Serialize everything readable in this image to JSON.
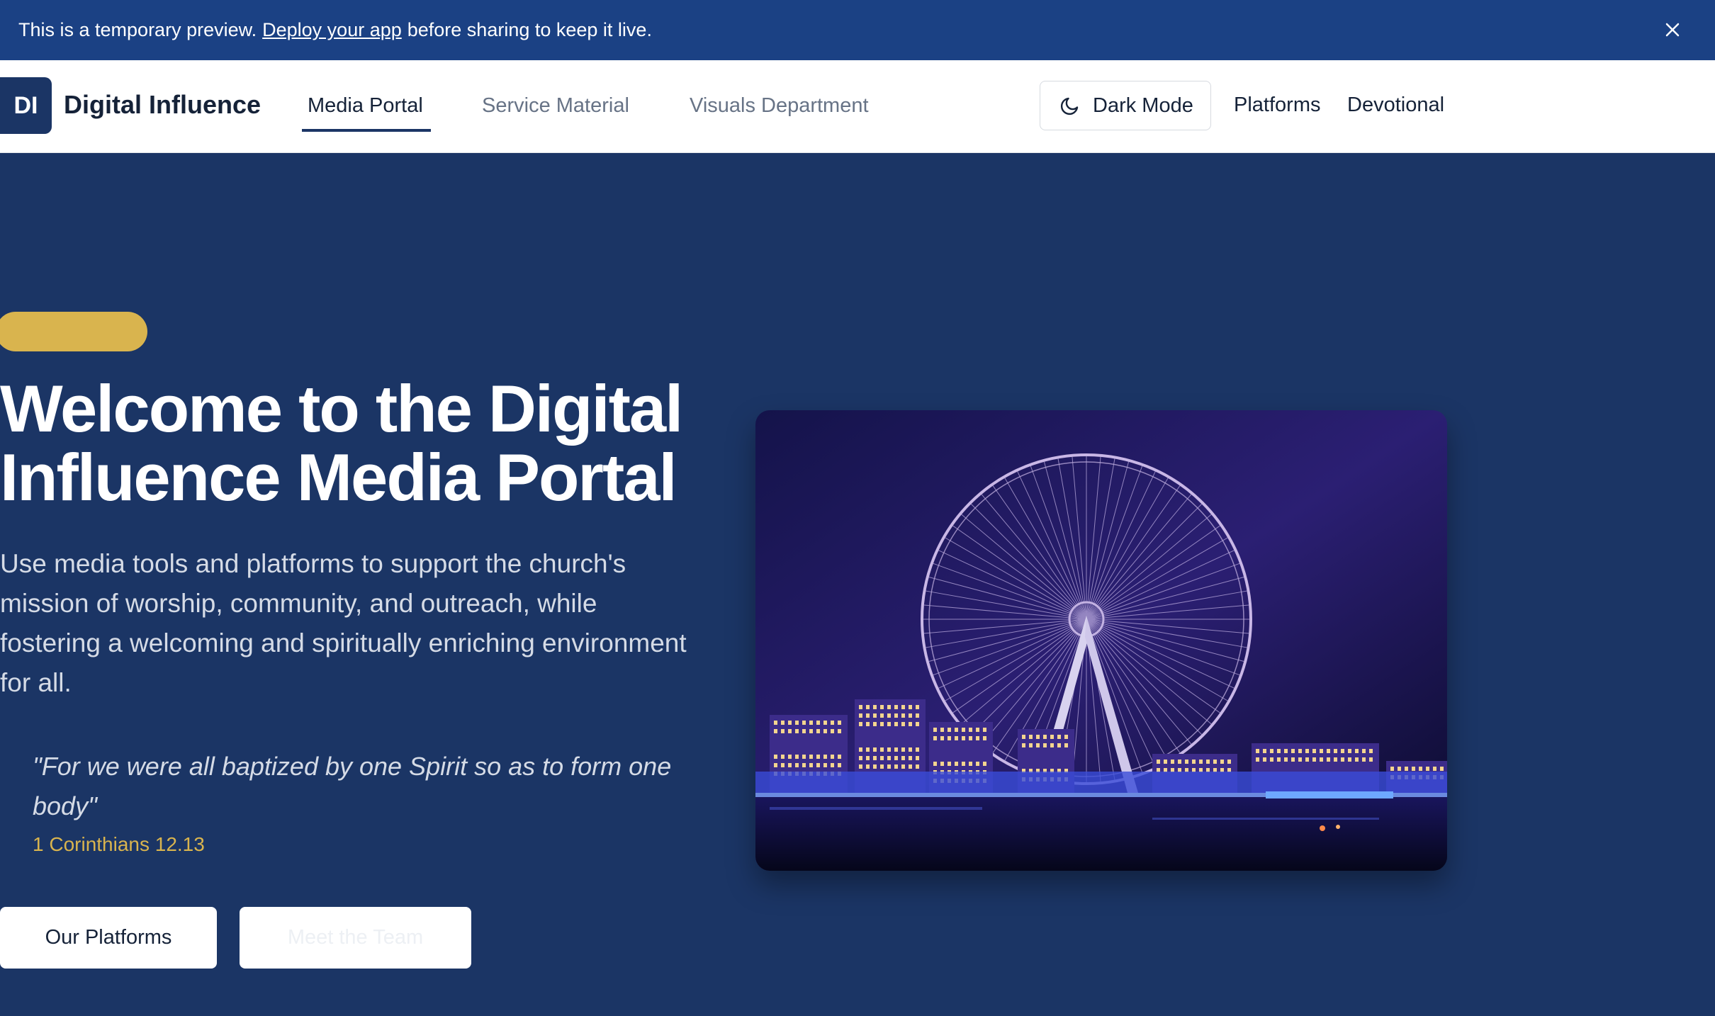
{
  "banner": {
    "text_before": "This is a temporary preview.",
    "link": "Deploy your app",
    "text_after": "before sharing to keep it live."
  },
  "header": {
    "logo_initials": "DI",
    "brand": "Digital Influence",
    "tabs": [
      {
        "label": "Media Portal",
        "active": true
      },
      {
        "label": "Service Material",
        "active": false
      },
      {
        "label": "Visuals Department",
        "active": false
      }
    ],
    "dark_mode_label": "Dark Mode",
    "links": [
      "Platforms",
      "Devotional"
    ]
  },
  "hero": {
    "title_line1": "Welcome to the Digital",
    "title_line2": "Influence Media Portal",
    "description": "Use media tools and platforms to support the church's mission of worship, community, and outreach, while fostering a welcoming and spiritually enriching environment for all.",
    "quote": "\"For we were all baptized by one Spirit so as to form one body\"",
    "quote_ref": "1 Corinthians 12.13",
    "primary_button": "Our Platforms",
    "secondary_button": "Meet the Team"
  },
  "colors": {
    "banner": "#1b4184",
    "navy": "#1b3565",
    "gold": "#d9b44e"
  }
}
